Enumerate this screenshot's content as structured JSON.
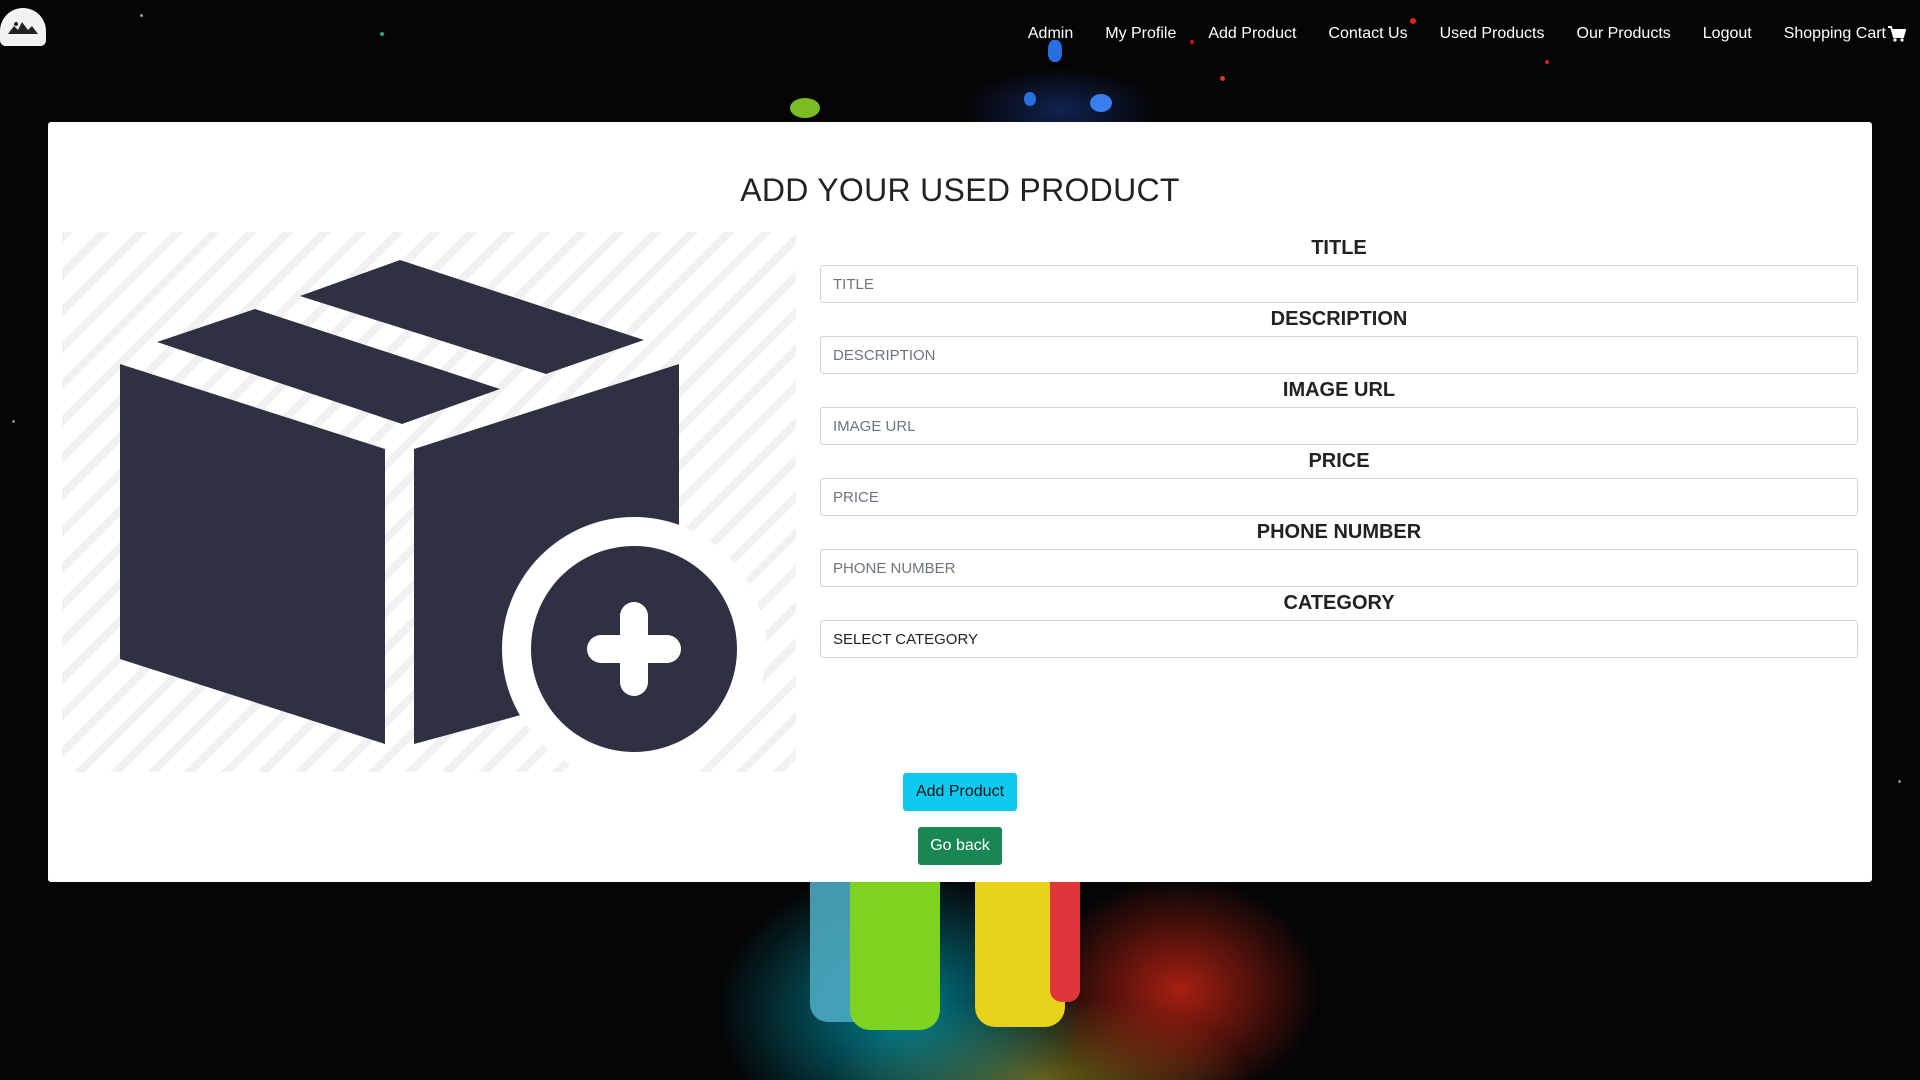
{
  "nav": {
    "logo": "site-logo",
    "links": [
      {
        "label": "Admin"
      },
      {
        "label": "My Profile"
      },
      {
        "label": "Add Product"
      },
      {
        "label": "Contact Us"
      },
      {
        "label": "Used Products"
      },
      {
        "label": "Our Products"
      },
      {
        "label": "Logout"
      },
      {
        "label": "Shopping Cart",
        "icon": "shopping-cart-icon"
      }
    ]
  },
  "main": {
    "title": "ADD YOUR USED PRODUCT",
    "illustration_icon": "box-add-icon",
    "form": {
      "fields": [
        {
          "label": "TITLE",
          "placeholder": "TITLE"
        },
        {
          "label": "DESCRIPTION",
          "placeholder": "DESCRIPTION"
        },
        {
          "label": "IMAGE URL",
          "placeholder": "IMAGE URL"
        },
        {
          "label": "PRICE",
          "placeholder": "PRICE"
        },
        {
          "label": "PHONE NUMBER",
          "placeholder": "PHONE NUMBER"
        }
      ],
      "category": {
        "label": "CATEGORY",
        "selected": "SELECT CATEGORY"
      }
    },
    "buttons": {
      "add_label": "Add Product",
      "back_label": "Go back"
    }
  },
  "colors": {
    "add_button": "#0dcaf0",
    "back_button": "#198754",
    "icon": "#2e3141"
  }
}
